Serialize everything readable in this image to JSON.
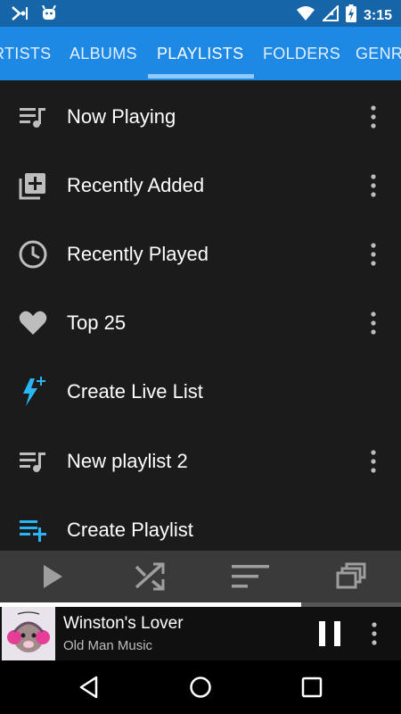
{
  "status": {
    "time": "3:15"
  },
  "tabs": [
    {
      "label": "RTISTS"
    },
    {
      "label": "ALBUMS"
    },
    {
      "label": "PLAYLISTS",
      "active": true
    },
    {
      "label": "FOLDERS"
    },
    {
      "label": "GENR"
    }
  ],
  "playlists": [
    {
      "label": "Now Playing",
      "icon": "queue-music-icon",
      "has_menu": true
    },
    {
      "label": "Recently Added",
      "icon": "library-add-icon",
      "has_menu": true
    },
    {
      "label": "Recently Played",
      "icon": "clock-icon",
      "has_menu": true
    },
    {
      "label": "Top 25",
      "icon": "heart-icon",
      "has_menu": true
    },
    {
      "label": "Create Live List",
      "icon": "bolt-plus-icon",
      "has_menu": false
    },
    {
      "label": "New playlist 2",
      "icon": "queue-music-icon",
      "has_menu": true
    },
    {
      "label": "Create Playlist",
      "icon": "playlist-add-icon",
      "has_menu": false
    }
  ],
  "controls": [
    "play-icon",
    "shuffle-icon",
    "sort-icon",
    "queue-icon"
  ],
  "now_playing": {
    "title": "Winston's Lover",
    "artist": "Old Man Music",
    "progress_fraction": 0.75
  },
  "colors": {
    "status_bar": "#1565a8",
    "tab_bar": "#1e88e5",
    "accent": "#29b6f6",
    "icon_grey": "#bdbdbd",
    "list_bg": "#1b1b1b",
    "controls_bg": "#3a3a3a"
  }
}
